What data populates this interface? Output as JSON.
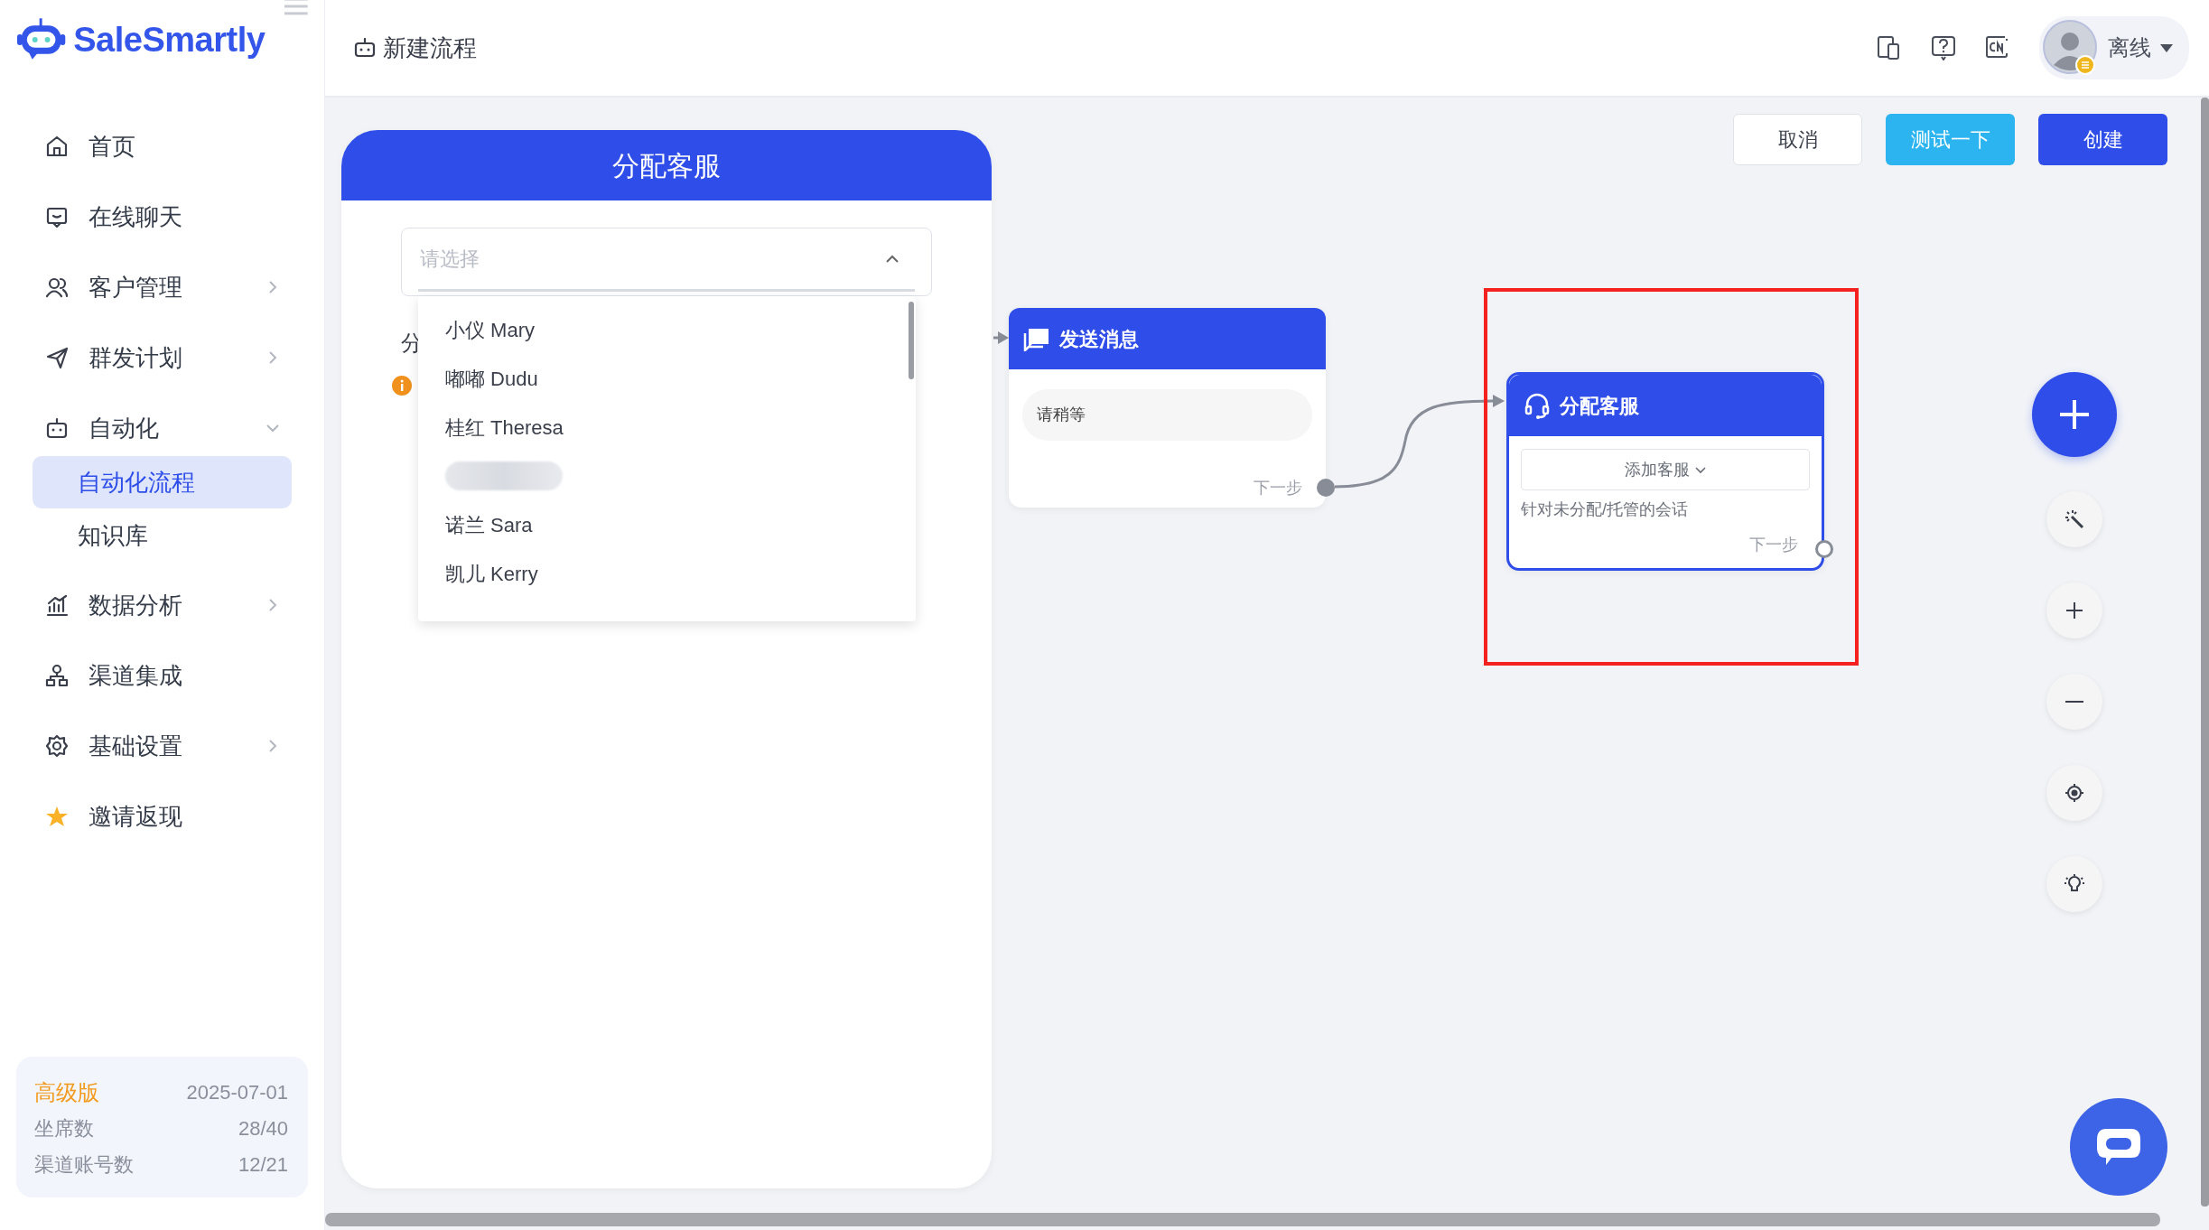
{
  "brand": {
    "name": "SaleSmartly"
  },
  "sidebar": {
    "items": [
      {
        "label": "首页",
        "kind": "link",
        "selected": false
      },
      {
        "label": "在线聊天",
        "kind": "link",
        "selected": false
      },
      {
        "label": "客户管理",
        "kind": "group",
        "expanded": false,
        "selected": false
      },
      {
        "label": "群发计划",
        "kind": "group",
        "expanded": false,
        "selected": false
      },
      {
        "label": "自动化",
        "kind": "group",
        "expanded": true,
        "selected": false,
        "children": [
          {
            "label": "自动化流程",
            "selected": true
          },
          {
            "label": "知识库",
            "selected": false
          }
        ]
      },
      {
        "label": "数据分析",
        "kind": "group",
        "expanded": false,
        "selected": false
      },
      {
        "label": "渠道集成",
        "kind": "link",
        "selected": false
      },
      {
        "label": "基础设置",
        "kind": "group",
        "expanded": false,
        "selected": false
      },
      {
        "label": "邀请返现",
        "kind": "link",
        "selected": false
      }
    ]
  },
  "plan": {
    "name": "高级版",
    "expiry": "2025-07-01",
    "rows": [
      {
        "label": "坐席数",
        "value": "28/40"
      },
      {
        "label": "渠道账号数",
        "value": "12/21"
      }
    ]
  },
  "header": {
    "title": "新建流程",
    "status": "离线"
  },
  "actions": [
    {
      "label": "取消",
      "kind": "default"
    },
    {
      "label": "测试一下",
      "kind": "test"
    },
    {
      "label": "创建",
      "kind": "primary"
    }
  ],
  "panel": {
    "title": "分配客服",
    "select": {
      "placeholder": "请选择",
      "expanded": true
    },
    "label": "分",
    "options": [
      {
        "kind": "text",
        "label": "小仪 Mary"
      },
      {
        "kind": "text",
        "label": "嘟嘟 Dudu"
      },
      {
        "kind": "text",
        "label": "桂红 Theresa"
      },
      {
        "kind": "redacted"
      },
      {
        "kind": "text",
        "label": "诺兰 Sara"
      },
      {
        "kind": "text",
        "label": "凯儿 Kerry"
      }
    ]
  },
  "nodes": [
    {
      "kind": "message",
      "title": "发送消息",
      "message": "请稍等",
      "next": "下一步",
      "selected": false,
      "highlighted": false
    },
    {
      "kind": "assign",
      "title": "分配客服",
      "button": "添加客服",
      "note": "针对未分配/托管的会话",
      "next": "下一步",
      "selected": true,
      "highlighted": true
    }
  ]
}
